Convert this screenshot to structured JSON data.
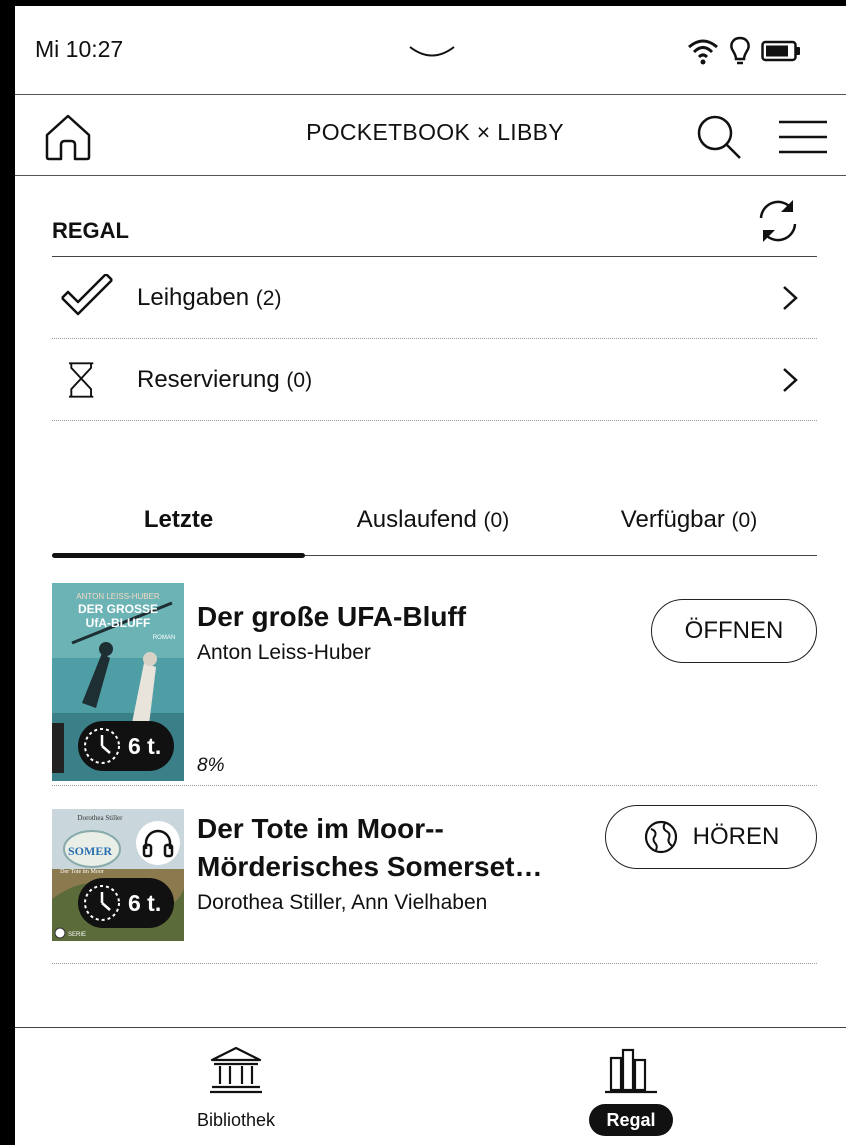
{
  "status": {
    "time": "Mi 10:27"
  },
  "header": {
    "title": "POCKETBOOK × LIBBY"
  },
  "shelf": {
    "title": "REGAL",
    "rows": [
      {
        "label": "Leihgaben",
        "count": "(2)"
      },
      {
        "label": "Reservierung",
        "count": "(0)"
      }
    ]
  },
  "tabs": [
    {
      "label": "Letzte",
      "count": "",
      "active": true
    },
    {
      "label": "Auslaufend",
      "count": "(0)",
      "active": false
    },
    {
      "label": "Verfügbar",
      "count": "(0)",
      "active": false
    }
  ],
  "books": [
    {
      "title": "Der große UFA-Bluff",
      "author": "Anton Leiss-Huber",
      "progress": "8%",
      "timer": "6 t.",
      "action": "ÖFFNEN",
      "cover": {
        "author": "ANTON LEISS-HUBER",
        "title_1": "DER GROSSE",
        "title_2": "UfA-BLUFF",
        "genre": "ROMAN"
      }
    },
    {
      "title_line1": "Der Tote im Moor--",
      "title_line2": "Mörderisches Somerset…",
      "author": "Dorothea Stiller, Ann Vielhaben",
      "timer": "6 t.",
      "action": "HÖREN",
      "format_icon": "headphones-icon",
      "cover": {
        "author": "Dorothea Stiller",
        "series": "SOMER",
        "subtitle": "Der Tote im Moor",
        "publisher": "SERIE"
      }
    }
  ],
  "bottom_nav": [
    {
      "label": "Bibliothek",
      "icon": "library-building-icon",
      "active": false
    },
    {
      "label": "Regal",
      "icon": "bookshelf-icon",
      "active": true
    }
  ]
}
